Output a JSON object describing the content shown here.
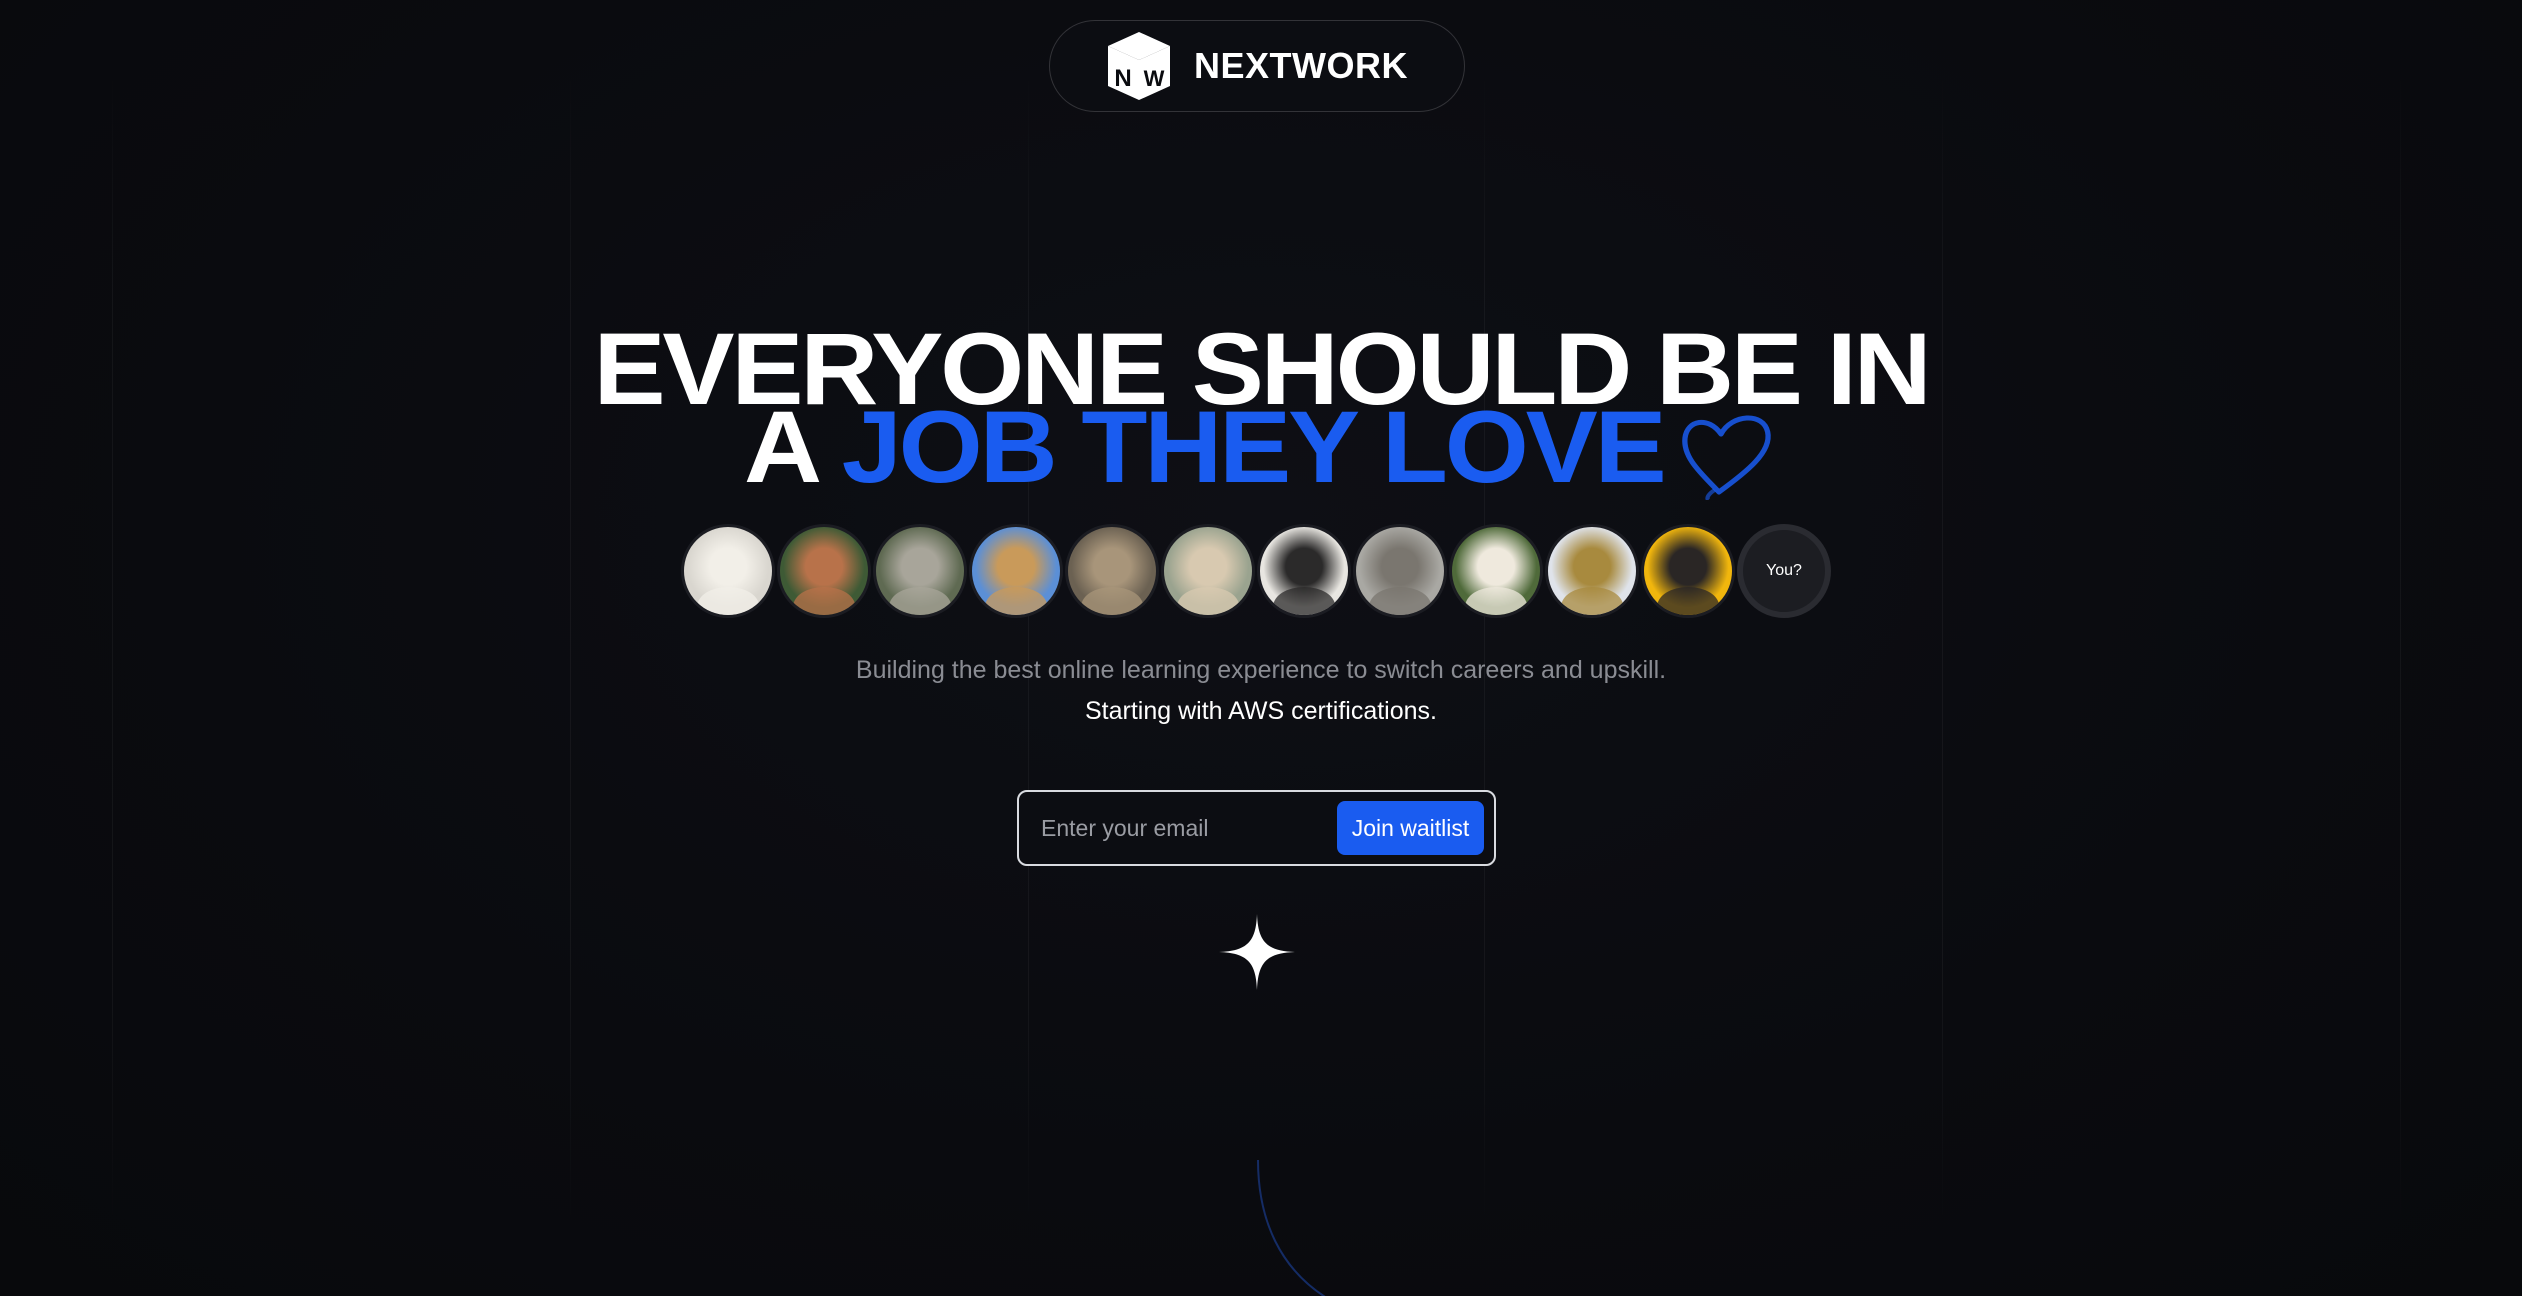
{
  "brand": {
    "name": "NEXTWORK",
    "logo_letters": [
      "N",
      "W"
    ]
  },
  "hero": {
    "line1": "EVERYONE SHOULD BE IN",
    "line2_prefix": "A ",
    "line2_accent": "JOB THEY LOVE"
  },
  "avatars": [
    {
      "name": "avatar-1",
      "bg": "#d9d6cf",
      "tone": "#f2efe8"
    },
    {
      "name": "avatar-2",
      "bg": "#3e5a35",
      "tone": "#b8724a"
    },
    {
      "name": "avatar-3",
      "bg": "#5f6a52",
      "tone": "#a8a59a"
    },
    {
      "name": "avatar-4",
      "bg": "#5b8fd6",
      "tone": "#c99a5a"
    },
    {
      "name": "avatar-5",
      "bg": "#6b6152",
      "tone": "#a8957a"
    },
    {
      "name": "avatar-6",
      "bg": "#9aa38f",
      "tone": "#d8c9b0"
    },
    {
      "name": "avatar-7",
      "bg": "#e8e6e1",
      "tone": "#2b2a2a"
    },
    {
      "name": "avatar-8",
      "bg": "#a9a8a3",
      "tone": "#7a766f"
    },
    {
      "name": "avatar-9",
      "bg": "#4f6a3a",
      "tone": "#efe9dd"
    },
    {
      "name": "avatar-10",
      "bg": "#dfe3ea",
      "tone": "#a88a3e"
    },
    {
      "name": "avatar-11",
      "bg": "#f1b60d",
      "tone": "#2a2625"
    }
  ],
  "you_label": "You?",
  "subtitle": "Building the best online learning experience to switch careers and upskill.",
  "subtitle_strong": "Starting with AWS certifications.",
  "form": {
    "placeholder": "Enter your email",
    "button_label": "Join waitlist"
  },
  "colors": {
    "accent": "#1a5cf0",
    "background": "#0a0b0f"
  }
}
